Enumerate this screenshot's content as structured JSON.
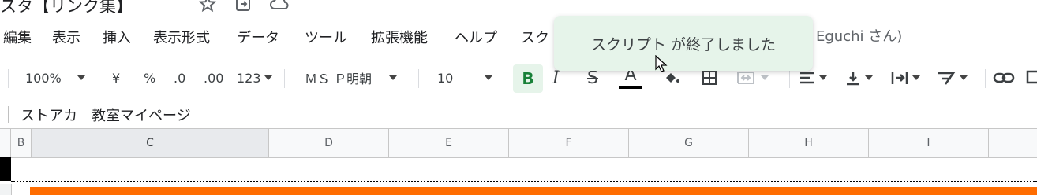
{
  "document": {
    "title": "スタ【リンク集】"
  },
  "menu": {
    "items": [
      "編集",
      "表示",
      "挿入",
      "表示形式",
      "データ",
      "ツール",
      "拡張機能",
      "ヘルプ",
      "スク"
    ],
    "last_edit": "Eguchi さん)"
  },
  "toolbar": {
    "zoom": "100%",
    "currency": "¥",
    "percent": "%",
    "decrease_decimal": ".0",
    "increase_decimal": ".00",
    "more_formats": "123",
    "font": "ＭＳ Ｐ明朝",
    "font_size": "10",
    "bold": "B",
    "italic": "I",
    "strike": "S",
    "text_color": "A",
    "text_color_value": "#000000"
  },
  "formula_bar": {
    "content": "ストアカ　教室マイページ"
  },
  "columns": [
    "B",
    "C",
    "D",
    "E",
    "F",
    "G",
    "H",
    "I"
  ],
  "toast": {
    "message": "スクリプト が終了しました"
  },
  "colors": {
    "toast_bg": "#e6f4ea",
    "bold_active": "#188038",
    "row_fill": "#ff6d01"
  }
}
